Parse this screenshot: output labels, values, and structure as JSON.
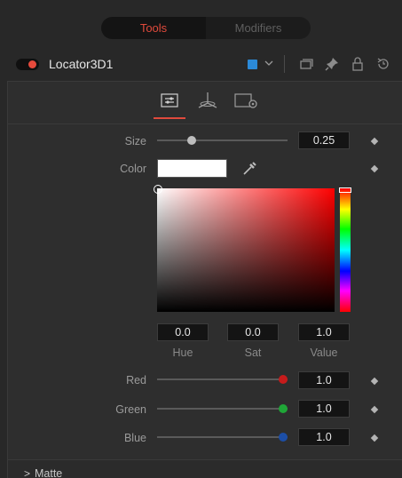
{
  "tabs": [
    {
      "label": "Tools",
      "active": true
    },
    {
      "label": "Modifiers",
      "active": false
    }
  ],
  "node": {
    "name": "Locator3D1",
    "enabled": true,
    "color": "#2b8ad8",
    "icons": [
      "chevron-down-icon",
      "versions-icon",
      "pin-icon",
      "lock-icon",
      "reset-icon"
    ]
  },
  "inspector_tabs": [
    {
      "icon": "controls-tab-icon",
      "active": true
    },
    {
      "icon": "transform-tab-icon",
      "active": false
    },
    {
      "icon": "settings-tab-icon",
      "active": false
    }
  ],
  "size": {
    "label": "Size",
    "value": "0.25",
    "fraction": 0.25
  },
  "color": {
    "label": "Color",
    "swatch": "#ffffff",
    "hue": {
      "label": "Hue",
      "value": "0.0"
    },
    "sat": {
      "label": "Sat",
      "value": "0.0"
    },
    "val": {
      "label": "Value",
      "value": "1.0"
    }
  },
  "channels": [
    {
      "key": "red",
      "label": "Red",
      "value": "1.0",
      "fraction": 1.0,
      "accent": "#c61b1b"
    },
    {
      "key": "green",
      "label": "Green",
      "value": "1.0",
      "fraction": 1.0,
      "accent": "#1fa637"
    },
    {
      "key": "blue",
      "label": "Blue",
      "value": "1.0",
      "fraction": 1.0,
      "accent": "#1c4ea6"
    }
  ],
  "sections": [
    {
      "label": "Matte",
      "expanded": false
    }
  ],
  "accent": "#e04a3c"
}
